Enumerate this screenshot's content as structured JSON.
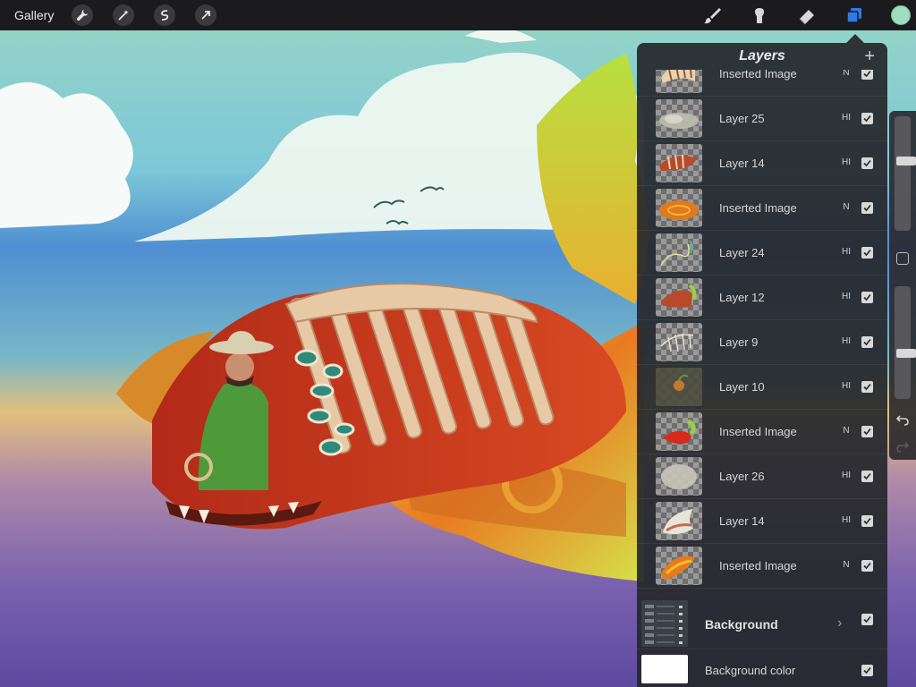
{
  "toolbar": {
    "gallery_label": "Gallery",
    "left_tools": [
      "wrench-icon",
      "magic-wand-icon",
      "selection-icon",
      "transform-arrow-icon"
    ],
    "right_tools": [
      "brush-icon",
      "smudge-icon",
      "eraser-icon",
      "layers-icon"
    ],
    "current_color": "#9fdcc0"
  },
  "layers_panel": {
    "title": "Layers",
    "add_label": "+",
    "layers": [
      {
        "name": "Inserted Image",
        "blend": "N",
        "visible": true
      },
      {
        "name": "Layer 25",
        "blend": "HI",
        "visible": true
      },
      {
        "name": "Layer 14",
        "blend": "HI",
        "visible": true
      },
      {
        "name": "Inserted Image",
        "blend": "N",
        "visible": true
      },
      {
        "name": "Layer 24",
        "blend": "HI",
        "visible": true
      },
      {
        "name": "Layer 12",
        "blend": "HI",
        "visible": true
      },
      {
        "name": "Layer 9",
        "blend": "HI",
        "visible": true
      },
      {
        "name": "Layer 10",
        "blend": "HI",
        "visible": true
      },
      {
        "name": "Inserted Image",
        "blend": "N",
        "visible": true
      },
      {
        "name": "Layer 26",
        "blend": "HI",
        "visible": true
      },
      {
        "name": "Layer 14",
        "blend": "HI",
        "visible": true
      },
      {
        "name": "Inserted Image",
        "blend": "N",
        "visible": true
      }
    ],
    "group": {
      "name": "Background",
      "chevron": "›",
      "visible": true
    },
    "background_color": {
      "label": "Background color",
      "visible": true
    }
  },
  "side_bar": {
    "brush_size": 0.62,
    "opacity": 0.4
  },
  "colors": {
    "sky_top": "#7fc9d4",
    "sky_band": "#4d8fd0",
    "haze": "#e7c47b",
    "ground": "#6a52a6",
    "accent_layers": "#2f7ae5"
  }
}
